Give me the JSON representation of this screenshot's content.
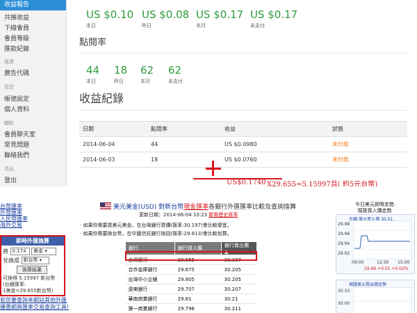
{
  "sidebar": {
    "items": [
      {
        "label": "收益報告",
        "active": true
      },
      {
        "label": "共推收益"
      },
      {
        "label": "下線會員"
      },
      {
        "label": "會員等級"
      },
      {
        "label": "匯款紀錄"
      },
      {
        "label": "廣告代碼"
      },
      {
        "label": "帳號設定"
      },
      {
        "label": "個人資料"
      },
      {
        "label": "會員聊天室"
      },
      {
        "label": "常見問題"
      },
      {
        "label": "聯絡我們"
      },
      {
        "label": "登出"
      }
    ],
    "groups": [
      "推廣",
      "設定",
      "輔助",
      "退出"
    ]
  },
  "earnings_summary": [
    {
      "value": "US $0.10",
      "label": "本日"
    },
    {
      "value": "US $0.08",
      "label": "昨日"
    },
    {
      "value": "US $0.17",
      "label": "本月"
    },
    {
      "value": "US $0.17",
      "label": "未支付"
    }
  ],
  "click_rate": {
    "title": "點閱率",
    "items": [
      {
        "value": "44",
        "label": "本日"
      },
      {
        "value": "18",
        "label": "昨日"
      },
      {
        "value": "62",
        "label": "本月"
      },
      {
        "value": "62",
        "label": "未支付"
      }
    ]
  },
  "records": {
    "title": "收益紀錄",
    "headers": [
      "日期",
      "點閱率",
      "收益",
      "狀態"
    ],
    "rows": [
      {
        "date": "2014-06-04",
        "clicks": "44",
        "earning": "US $0.0980",
        "status": "未付款"
      },
      {
        "date": "2014-06-03",
        "clicks": "18",
        "earning": "US $0.0760",
        "status": "未付款"
      }
    ]
  },
  "annotations": {
    "sum": "US$0.1740",
    "calc": "X29.655=5.15997且( 約5元台幣)"
  },
  "exchange": {
    "left_links": [
      "台幣匯率",
      "外幣匯率",
      "人民幣匯率",
      "海外交易"
    ],
    "converter": {
      "title": "即時外匯換算",
      "amount": "0.174",
      "from_currency": "美金",
      "to_label": "兌換成",
      "to_currency": "新台幣",
      "button": "換算結果",
      "result_lines": [
        "可換得 5.15997 新台幣",
        "(台銀匯率:",
        "1美金=29.655新台幣)"
      ]
    },
    "bottom_links": [
      "若您要查詢本網站其他外匯",
      "優惠網頁匯率交易查詢工具!"
    ],
    "title_prefix": "美元美金(USD) 對新台幣",
    "title_highlight": "現金匯率",
    "title_suffix": "各銀行外匯匯率比較及查詢換算",
    "updated": "更新日期：2014-06-04 10:23",
    "updated_link": "觀看歷史匯率",
    "tips": [
      "‧ 如果你需要買美元美金，在台灣銀行買價(匯率:30.197)會比較便宜。",
      "‧ 如果你需要換台幣，在中國信託銀行換回(匯率:29.813)會比較划算。"
    ],
    "table": {
      "headers": [
        "銀行",
        "銀行買入價",
        "銀行賣出價 ▲"
      ],
      "rows": [
        [
          "台灣銀行",
          "29.655",
          "30.197"
        ],
        [
          "合作金庫銀行",
          "29.675",
          "30.205"
        ],
        [
          "台灣中小企銀",
          "29.805",
          "30.205"
        ],
        [
          "遠東銀行",
          "29.707",
          "30.207"
        ],
        [
          "華南商業銀行",
          "29.81",
          "30.21"
        ],
        [
          "第一商業銀行",
          "29.796",
          "30.211"
        ]
      ]
    },
    "chart_buy": {
      "title_lines": [
        "今日美元即時走勢",
        "現匯買入價走勢"
      ],
      "legend": "台銀-美元買入價 30.01",
      "yticks": [
        "29.98",
        "29.96",
        "29.94",
        "29.92"
      ],
      "xticks": [
        "09:00",
        "12:30",
        "15:00"
      ],
      "summary": "29.96 +0.01 +0.02%"
    },
    "chart_sell": {
      "legend": "現匯美元賣出價走勢",
      "yticks": [
        "30.10",
        "30.00"
      ]
    }
  }
}
